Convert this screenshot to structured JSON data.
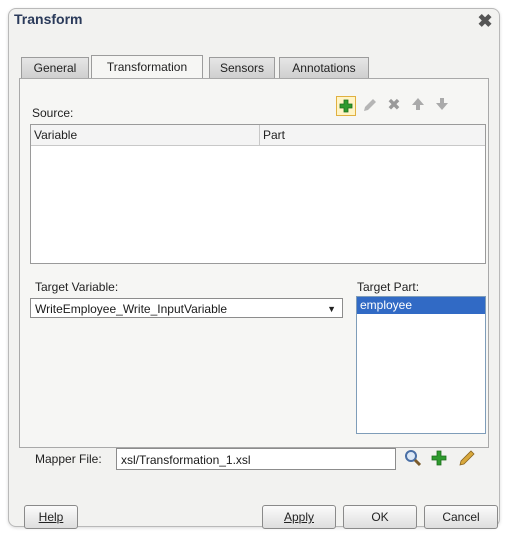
{
  "window": {
    "title": "Transform"
  },
  "tabs": [
    {
      "label": "General"
    },
    {
      "label": "Transformation"
    },
    {
      "label": "Sensors"
    },
    {
      "label": "Annotations"
    }
  ],
  "source": {
    "label": "Source:",
    "columns": [
      "Variable",
      "Part"
    ],
    "rows": []
  },
  "target_variable": {
    "label": "Target Variable:",
    "value": "WriteEmployee_Write_InputVariable"
  },
  "target_part": {
    "label": "Target Part:",
    "items": [
      "employee"
    ]
  },
  "mapper": {
    "label": "Mapper File:",
    "value": "xsl/Transformation_1.xsl"
  },
  "buttons": {
    "help": "Help",
    "apply": "Apply",
    "ok": "OK",
    "cancel": "Cancel"
  },
  "colors": {
    "selection": "#316ac5",
    "add_icon": "#2e9a2e",
    "edit_icon": "#c9a23c"
  }
}
